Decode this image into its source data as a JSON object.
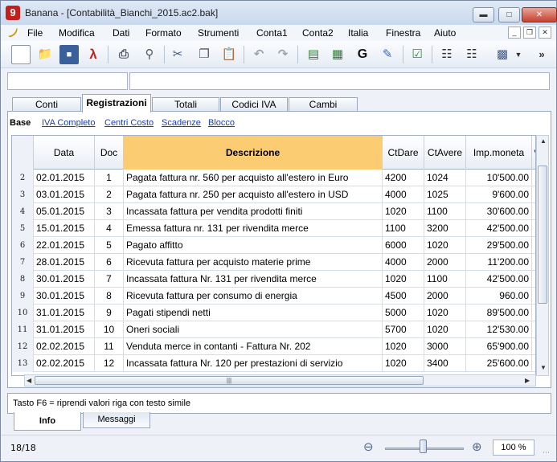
{
  "window": {
    "title": "Banana - [Contabilità_Bianchi_2015.ac2.bak]",
    "app_icon": "banana-9-logo",
    "controls": [
      "minimize",
      "maximize",
      "close"
    ]
  },
  "menu": {
    "items": [
      "File",
      "Modifica",
      "Dati",
      "Formato",
      "Strumenti",
      "Conta1",
      "Conta2",
      "Italia",
      "Finestra",
      "Aiuto"
    ]
  },
  "toolbar": {
    "icons": [
      "new-file-icon",
      "open-folder-icon",
      "save-icon",
      "pdf-icon",
      "print-icon",
      "print-preview-icon",
      "cut-icon",
      "copy-icon",
      "paste-icon",
      "undo-icon",
      "redo-icon",
      "insert-row-icon",
      "delete-row-icon",
      "go-to-icon",
      "edit-icon",
      "check-accounts-icon",
      "find-icon",
      "find-next-icon",
      "print-report-icon",
      "more-icon"
    ],
    "go_label": "G"
  },
  "tabs": {
    "items": [
      "Conti",
      "Registrazioni",
      "Totali",
      "Codici IVA",
      "Cambi"
    ],
    "active": "Registrazioni"
  },
  "views": {
    "items": [
      "Base",
      "IVA Completo",
      "Centri Costo",
      "Scadenze",
      "Blocco"
    ],
    "active": "Base"
  },
  "table": {
    "headers": [
      "Data",
      "Doc",
      "Descrizione",
      "CtDare",
      "CtAvere",
      "Imp.moneta",
      "v"
    ],
    "rows": [
      {
        "n": "2",
        "data": "02.01.2015",
        "doc": "1",
        "desc": "Pagata fattura nr. 560 per acquisto all'estero in Euro",
        "dare": "4200",
        "avere": "1024",
        "imp": "10'500.00"
      },
      {
        "n": "3",
        "data": "03.01.2015",
        "doc": "2",
        "desc": "Pagata fattura nr. 250 per acquisto all'estero in USD",
        "dare": "4000",
        "avere": "1025",
        "imp": "9'600.00"
      },
      {
        "n": "4",
        "data": "05.01.2015",
        "doc": "3",
        "desc": "Incassata fattura per vendita prodotti finiti",
        "dare": "1020",
        "avere": "1100",
        "imp": "30'600.00"
      },
      {
        "n": "5",
        "data": "15.01.2015",
        "doc": "4",
        "desc": "Emessa fattura nr. 131 per rivendita merce",
        "dare": "1100",
        "avere": "3200",
        "imp": "42'500.00"
      },
      {
        "n": "6",
        "data": "22.01.2015",
        "doc": "5",
        "desc": "Pagato affitto",
        "dare": "6000",
        "avere": "1020",
        "imp": "29'500.00"
      },
      {
        "n": "7",
        "data": "28.01.2015",
        "doc": "6",
        "desc": "Ricevuta fattura per acquisto materie prime",
        "dare": "4000",
        "avere": "2000",
        "imp": "11'200.00"
      },
      {
        "n": "8",
        "data": "30.01.2015",
        "doc": "7",
        "desc": "Incassata fattura Nr. 131 per rivendita merce",
        "dare": "1020",
        "avere": "1100",
        "imp": "42'500.00"
      },
      {
        "n": "9",
        "data": "30.01.2015",
        "doc": "8",
        "desc": "Ricevuta fattura per consumo di energia",
        "dare": "4500",
        "avere": "2000",
        "imp": "960.00"
      },
      {
        "n": "10",
        "data": "31.01.2015",
        "doc": "9",
        "desc": "Pagati stipendi netti",
        "dare": "5000",
        "avere": "1020",
        "imp": "89'500.00"
      },
      {
        "n": "11",
        "data": "31.01.2015",
        "doc": "10",
        "desc": "Oneri sociali",
        "dare": "5700",
        "avere": "1020",
        "imp": "12'530.00"
      },
      {
        "n": "12",
        "data": "02.02.2015",
        "doc": "11",
        "desc": "Venduta merce in contanti - Fattura Nr. 202",
        "dare": "1020",
        "avere": "3000",
        "imp": "65'900.00"
      },
      {
        "n": "13",
        "data": "02.02.2015",
        "doc": "12",
        "desc": "Incassata fattura Nr. 120 per prestazioni di servizio",
        "dare": "1020",
        "avere": "3400",
        "imp": "25'600.00"
      }
    ]
  },
  "info": {
    "message": "Tasto F6 = riprendi valori riga con testo simile",
    "tabs": [
      "Info",
      "Messaggi"
    ],
    "active": "Info"
  },
  "status": {
    "position": "18/18",
    "zoom": "100 %"
  }
}
